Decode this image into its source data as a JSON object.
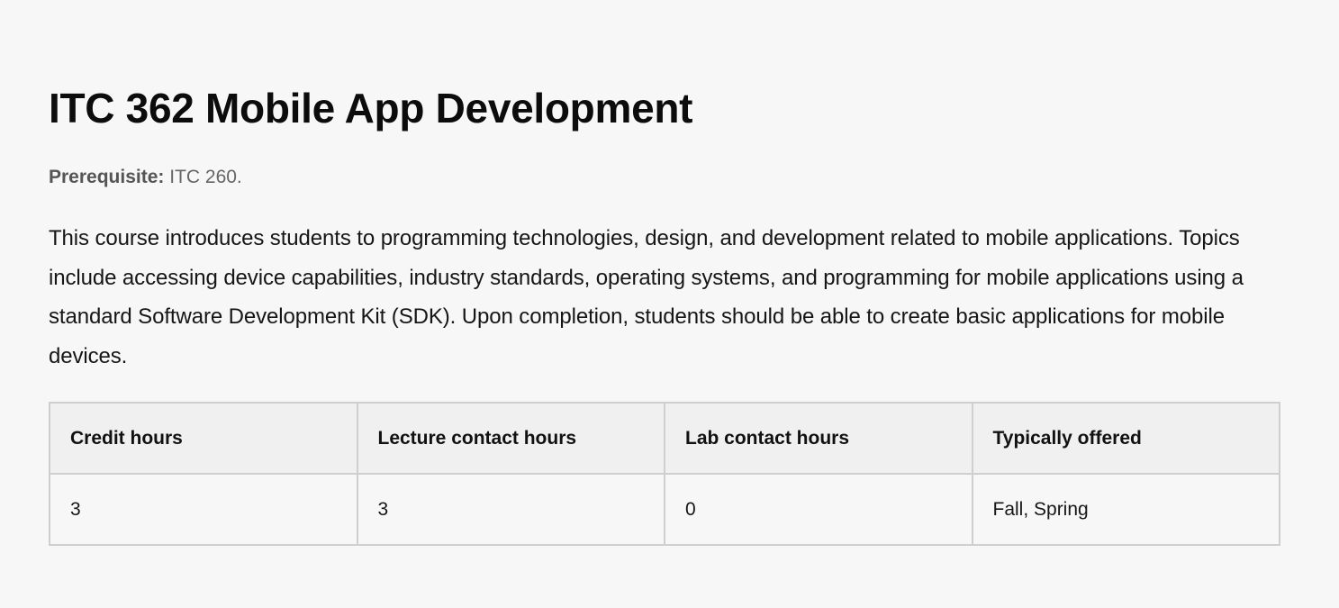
{
  "course": {
    "title": "ITC 362 Mobile App Development",
    "prerequisite_label": "Prerequisite:",
    "prerequisite_value": "ITC 260.",
    "description": "This course introduces students to programming technologies, design, and development related to mobile applications. Topics include accessing device capabilities, industry standards, operating systems, and programming for mobile applications using a standard Software Development Kit (SDK). Upon completion, students should be able to create basic applications for mobile devices."
  },
  "table": {
    "headers": [
      "Credit hours",
      "Lecture contact hours",
      "Lab contact hours",
      "Typically offered"
    ],
    "rows": [
      [
        "3",
        "3",
        "0",
        "Fall, Spring"
      ]
    ]
  }
}
